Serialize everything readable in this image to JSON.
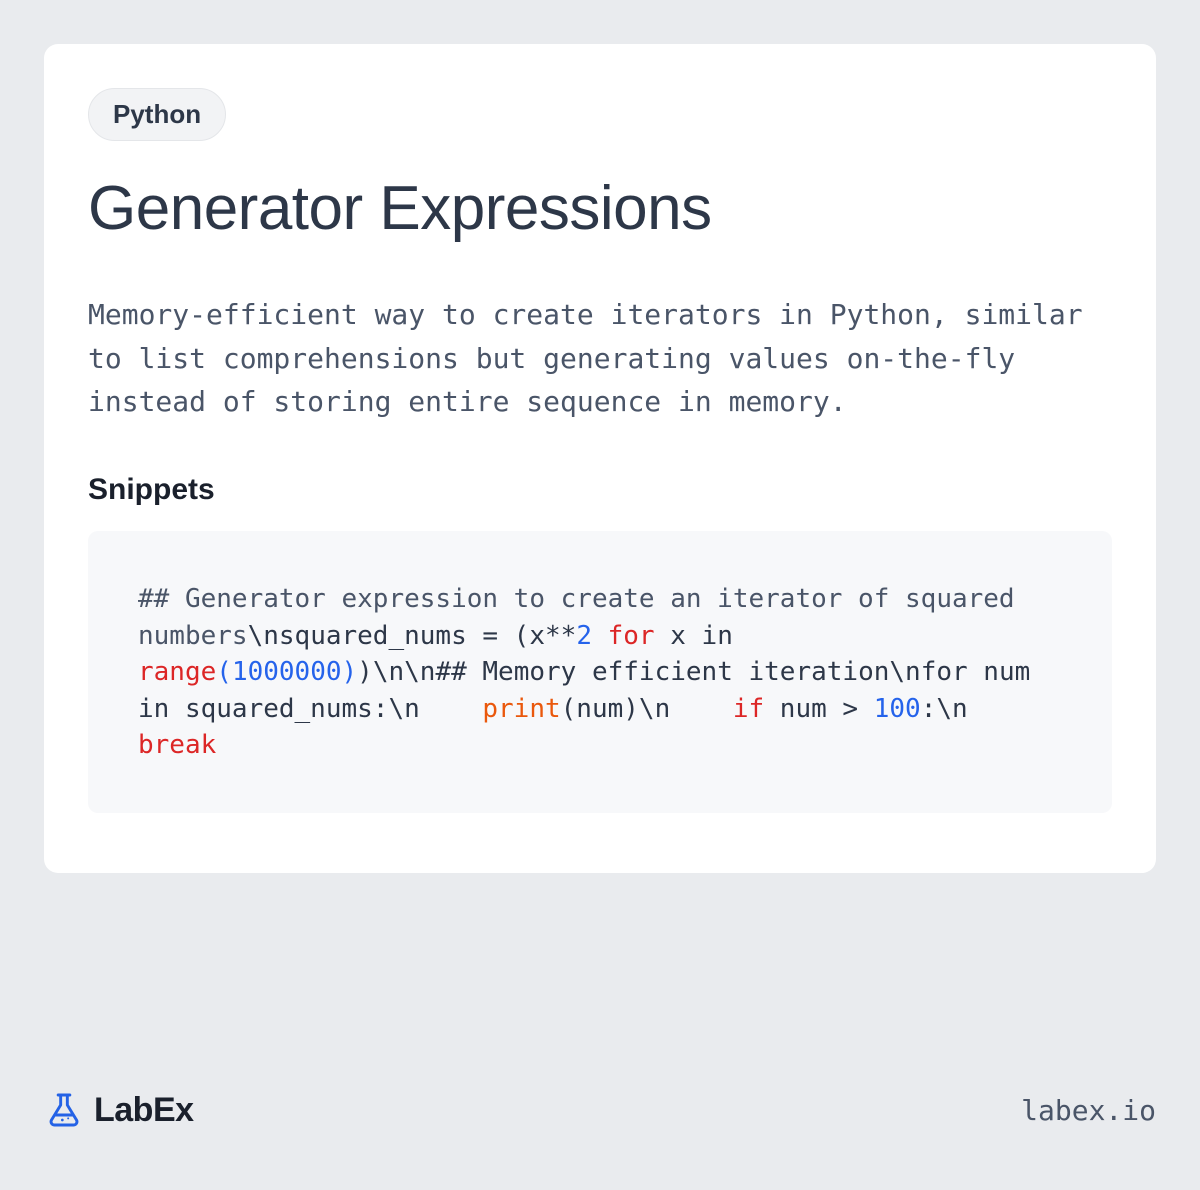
{
  "tag": "Python",
  "title": "Generator Expressions",
  "description": "Memory-efficient way to create iterators in Python, similar to list comprehensions but generating values on-the-fly instead of storing entire sequence in memory.",
  "snippets_heading": "Snippets",
  "code": {
    "tokens": [
      {
        "cls": "tok-comment",
        "t": "## Generator expression to create an iterator of squared numbers"
      },
      {
        "cls": "",
        "t": "\\nsquared_nums = (x**"
      },
      {
        "cls": "tok-number",
        "t": "2"
      },
      {
        "cls": "",
        "t": " "
      },
      {
        "cls": "tok-keyword",
        "t": "for"
      },
      {
        "cls": "",
        "t": " x in "
      },
      {
        "cls": "tok-keyword",
        "t": "range"
      },
      {
        "cls": "tok-paren",
        "t": "("
      },
      {
        "cls": "tok-number",
        "t": "1000000"
      },
      {
        "cls": "tok-paren",
        "t": ")"
      },
      {
        "cls": "",
        "t": ")\\n\\n## Memory efficient iteration\\nfor num in squared_nums:\\n    "
      },
      {
        "cls": "tok-builtin",
        "t": "print"
      },
      {
        "cls": "",
        "t": "(num)\\n    "
      },
      {
        "cls": "tok-keyword",
        "t": "if"
      },
      {
        "cls": "",
        "t": " num > "
      },
      {
        "cls": "tok-number",
        "t": "100"
      },
      {
        "cls": "",
        "t": ":\\n        "
      },
      {
        "cls": "tok-keyword",
        "t": "break"
      }
    ]
  },
  "brand": "LabEx",
  "site_url": "labex.io"
}
